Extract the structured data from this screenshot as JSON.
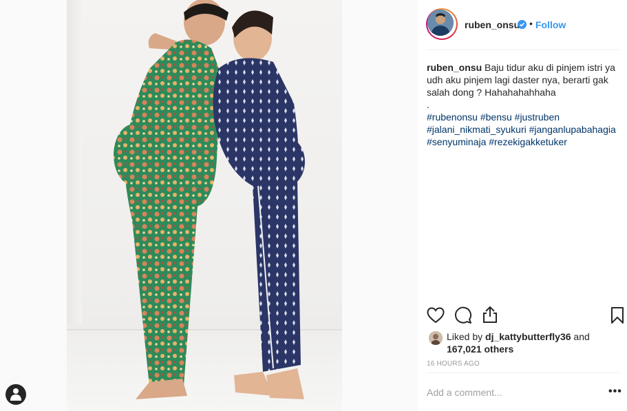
{
  "post": {
    "username": "ruben_onsu",
    "follow_label": "Follow",
    "separator": "•",
    "caption_text": "Baju tidur aku di pinjem istri ya udh aku pinjem lagi daster nya, berarti gak salah dong ? Hahahahahhaha",
    "caption_period": ".",
    "hashtags": [
      "#rubenonsu #bensu #justruben",
      "#jalani_nikmati_syukuri #janganlupabahagia",
      "#senyuminaja #rezekigakketuker"
    ],
    "liked_by_prefix": "Liked by",
    "liked_by_user": "dj_kattybutterfly36",
    "liked_by_and": "and",
    "likes_count": "167,021 others",
    "timestamp": "16 HOURS AGO",
    "comment_placeholder": "Add a comment...",
    "more_label": "•••"
  },
  "icons": {
    "like": "heart-icon",
    "comment": "comment-icon",
    "share": "share-icon",
    "save": "bookmark-icon",
    "verified": "verified-badge-icon",
    "profile": "user-silhouette-icon"
  },
  "colors": {
    "link": "#3897f0",
    "hashtag": "#003569",
    "text": "#262626",
    "muted": "#999999",
    "verified": "#3897f0"
  }
}
